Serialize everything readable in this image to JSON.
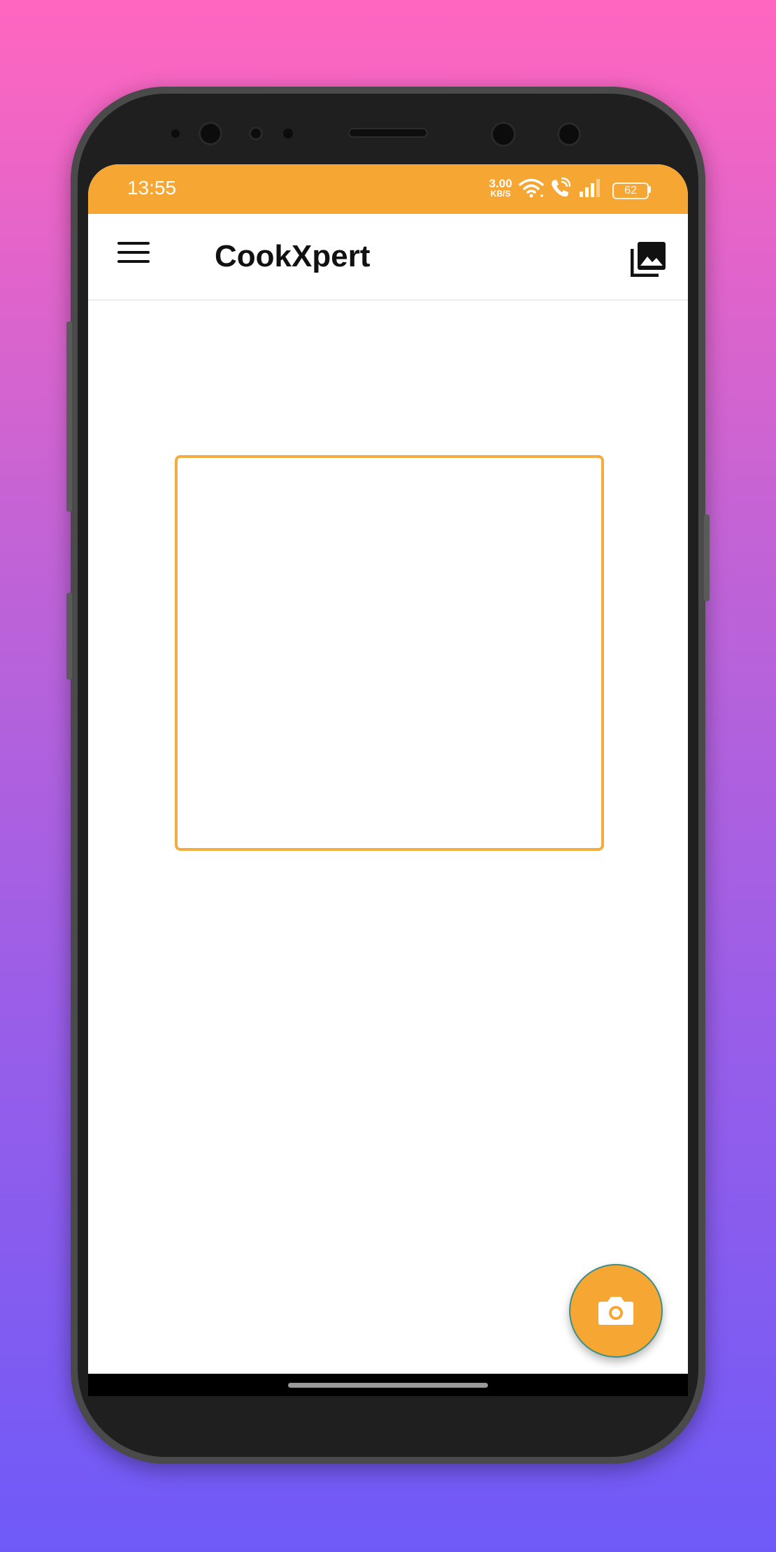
{
  "status_bar": {
    "time": "13:55",
    "speed_value": "3.00",
    "speed_unit": "KB/S",
    "battery": "62"
  },
  "app_bar": {
    "title": "CookXpert"
  },
  "icons": {
    "menu": "menu-icon",
    "gallery": "gallery-icon",
    "camera": "camera-icon",
    "wifi": "wifi-icon",
    "call": "wifi-call-icon",
    "signal": "signal-icon",
    "battery": "battery-icon"
  },
  "colors": {
    "accent": "#f6a633",
    "frame_border": "#f2ac40",
    "fab_border": "#3c8f86",
    "background_top": "#ff66bf",
    "background_bottom": "#6f5af8"
  }
}
